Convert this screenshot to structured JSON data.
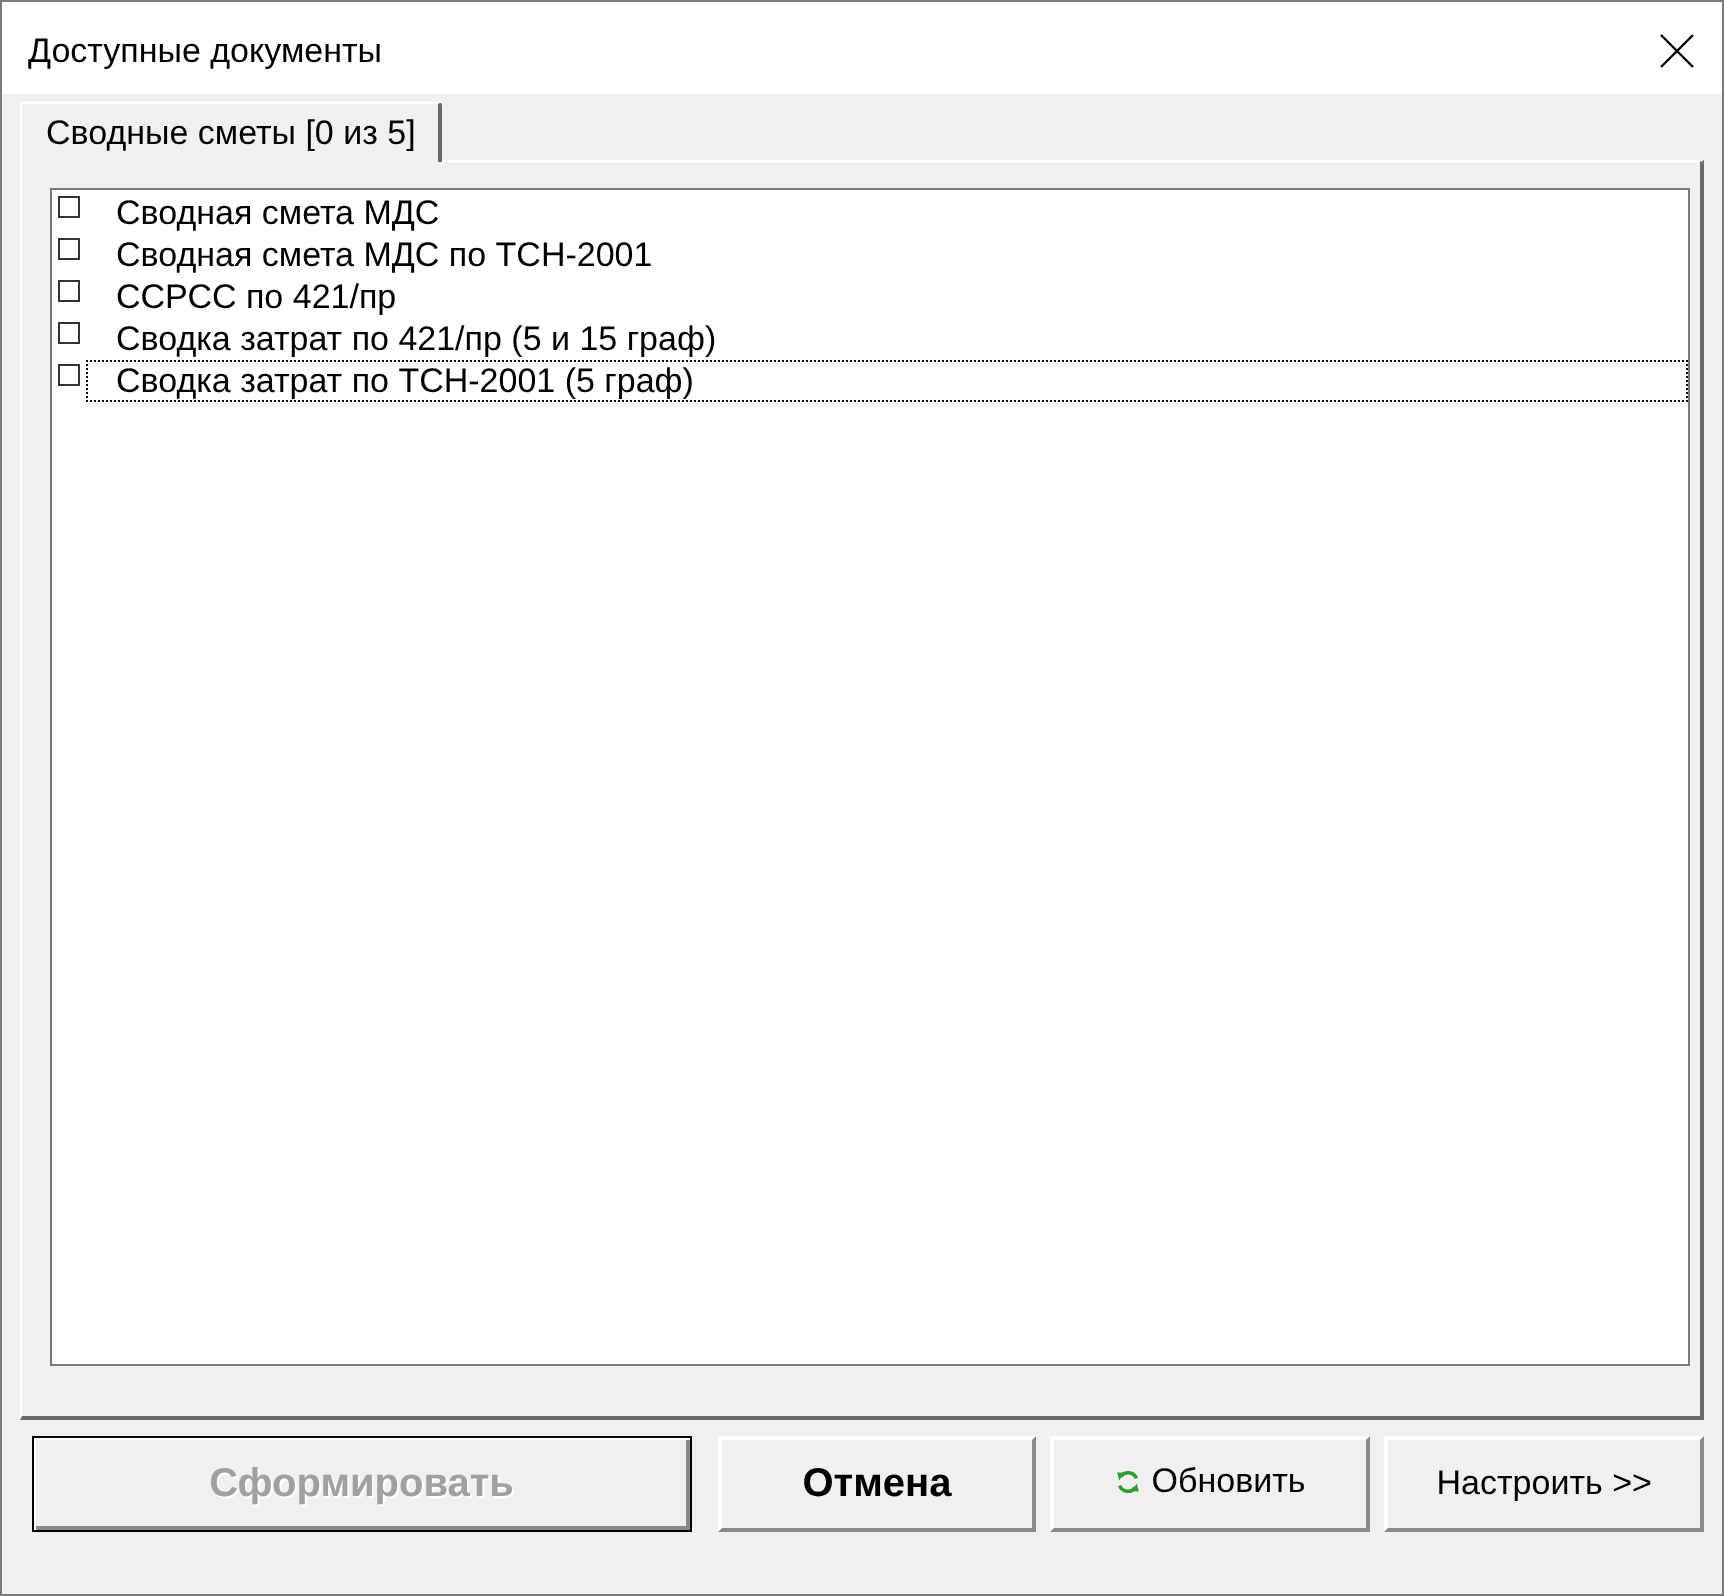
{
  "window": {
    "title": "Доступные документы"
  },
  "tabs": [
    {
      "label": "Сводные сметы [0 из 5]",
      "selected": true
    }
  ],
  "documents": [
    {
      "label": "Сводная смета МДС",
      "checked": false,
      "focused": false
    },
    {
      "label": "Сводная смета МДС по ТСН-2001",
      "checked": false,
      "focused": false
    },
    {
      "label": "ССРСС по 421/пр",
      "checked": false,
      "focused": false
    },
    {
      "label": "Сводка затрат по 421/пр (5 и 15 граф)",
      "checked": false,
      "focused": false
    },
    {
      "label": "Сводка затрат по ТСН-2001 (5 граф)",
      "checked": false,
      "focused": true
    }
  ],
  "buttons": [
    {
      "label": "Сформировать",
      "kind": "default",
      "disabled": true
    },
    {
      "label": "Отмена",
      "kind": "bold",
      "disabled": false
    },
    {
      "label": "Обновить",
      "kind": "refresh",
      "disabled": false
    },
    {
      "label": "Настроить >>",
      "kind": "plain",
      "disabled": false
    }
  ]
}
